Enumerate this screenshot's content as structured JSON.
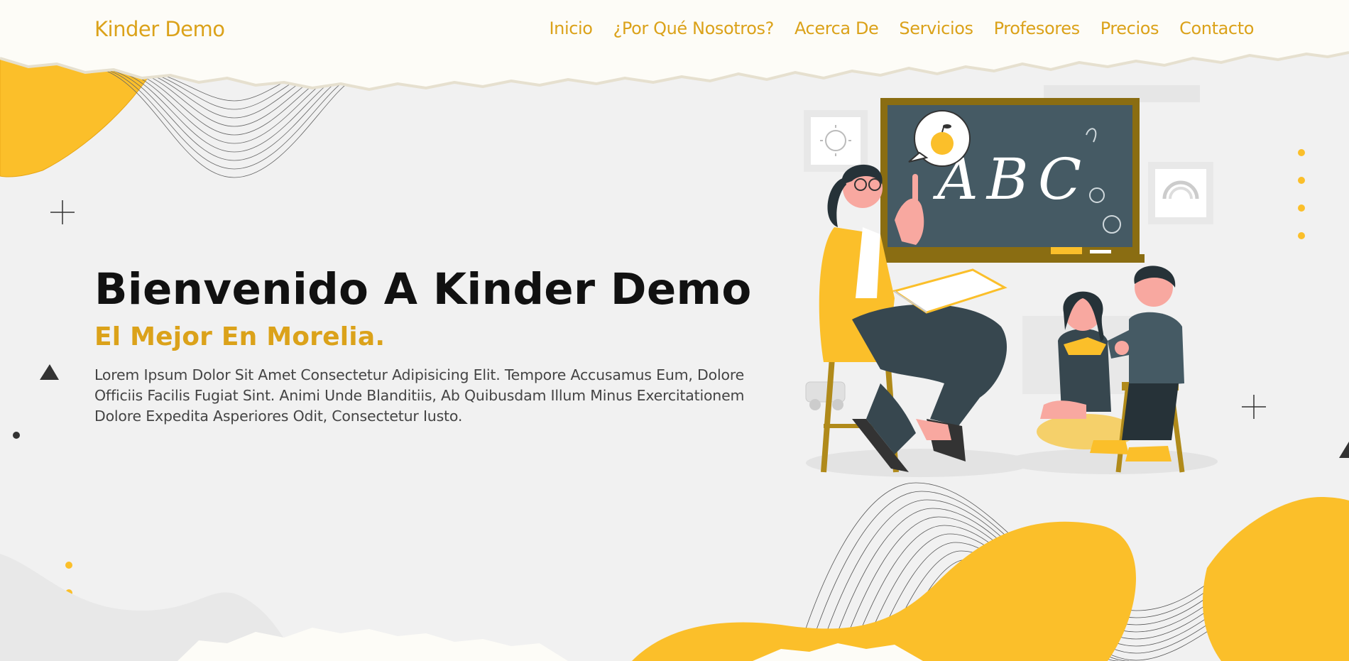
{
  "brand": "Kinder Demo",
  "nav": [
    "Inicio",
    "¿Por Qué Nosotros?",
    "Acerca De",
    "Servicios",
    "Profesores",
    "Precios",
    "Contacto"
  ],
  "hero": {
    "title": "Bienvenido A Kinder Demo",
    "subtitle": "El Mejor En Morelia.",
    "body": "Lorem Ipsum Dolor Sit Amet Consectetur Adipisicing Elit. Tempore Accusamus Eum, Dolore Officiis Facilis Fugiat Sint. Animi Unde Blanditiis, Ab Quibusdam Illum Minus Exercitationem Dolore Expedita Asperiores Odit, Consectetur Iusto."
  },
  "illustration": {
    "chalkboard_text": "ABC"
  },
  "colors": {
    "accent": "#dba21a",
    "yellow": "#fbbf2a",
    "dark": "#37474f",
    "background": "#f1f1f1"
  }
}
